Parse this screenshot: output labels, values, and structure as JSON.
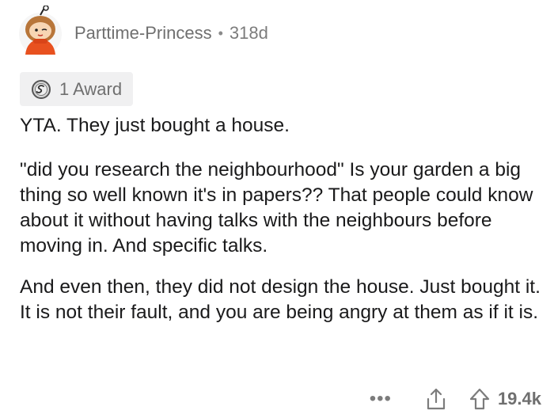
{
  "comment": {
    "author": "Parttime-Princess",
    "separator": "•",
    "age": "318d",
    "award_label": "1 Award",
    "paragraphs": [
      "YTA. They just bought a house.",
      "\"did you research the neighbourhood\" Is your garden a big thing so well known it's in papers?? That people could know about it without having talks with the neighbours before moving in. And specific talks.",
      "And even then, they did not design the house. Just bought it. It is not their fault, and you are being angry at them as if it is."
    ],
    "more_label": "•••",
    "score": "19.4k"
  },
  "icons": {
    "avatar": "avatar-icon",
    "award": "award-icon",
    "more": "more-options-icon",
    "share": "share-icon",
    "upvote": "upvote-icon"
  },
  "colors": {
    "text": "#1a1a1b",
    "meta": "#7c7c7c",
    "award_bg": "#f0f0f1",
    "avatar_orange": "#e8511f"
  }
}
